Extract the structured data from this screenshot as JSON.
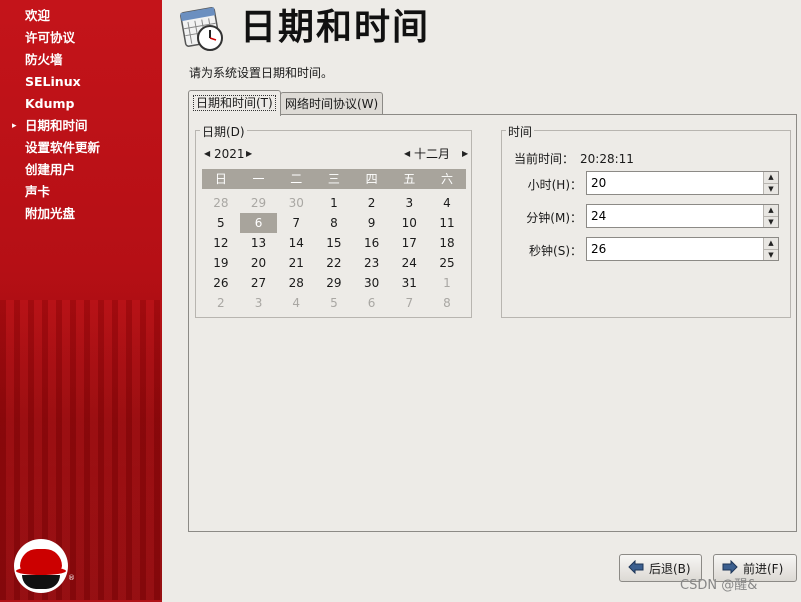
{
  "sidebar": {
    "items": [
      {
        "label": "欢迎"
      },
      {
        "label": "许可协议"
      },
      {
        "label": "防火墙"
      },
      {
        "label": "SELinux"
      },
      {
        "label": "Kdump"
      },
      {
        "label": "日期和时间",
        "current": true
      },
      {
        "label": "设置软件更新"
      },
      {
        "label": "创建用户"
      },
      {
        "label": "声卡"
      },
      {
        "label": "附加光盘"
      }
    ],
    "current_marker": "▸"
  },
  "header": {
    "title": "日期和时间",
    "icon": "calendar-clock-icon",
    "instruction": "请为系统设置日期和时间。"
  },
  "tabs": [
    {
      "label": "日期和时间(T)",
      "active": true
    },
    {
      "label": "网络时间协议(W)",
      "active": false
    }
  ],
  "date": {
    "group_label": "日期(D)",
    "year": "2021",
    "month": "十二月",
    "weekdays": [
      "日",
      "一",
      "二",
      "三",
      "四",
      "五",
      "六"
    ],
    "weeks": [
      [
        "28",
        "29",
        "30",
        "1",
        "2",
        "3",
        "4"
      ],
      [
        "5",
        "6",
        "7",
        "8",
        "9",
        "10",
        "11"
      ],
      [
        "12",
        "13",
        "14",
        "15",
        "16",
        "17",
        "18"
      ],
      [
        "19",
        "20",
        "21",
        "22",
        "23",
        "24",
        "25"
      ],
      [
        "26",
        "27",
        "28",
        "29",
        "30",
        "31",
        "1"
      ],
      [
        "2",
        "3",
        "4",
        "5",
        "6",
        "7",
        "8"
      ]
    ],
    "selected_day": "6"
  },
  "time": {
    "group_label": "时间",
    "current_label": "当前时间：",
    "current_value": "20:28:11",
    "hour_label": "小时(H)：",
    "hour_value": "20",
    "minute_label": "分钟(M)：",
    "minute_value": "24",
    "second_label": "秒钟(S)：",
    "second_value": "26"
  },
  "buttons": {
    "back": "后退(B)",
    "next": "前进(F)"
  },
  "watermark": "CSDN @醒&",
  "colors": {
    "sidebar_red": "#c4141a",
    "calendar_header": "#a8a49c",
    "background": "#edebe7"
  }
}
